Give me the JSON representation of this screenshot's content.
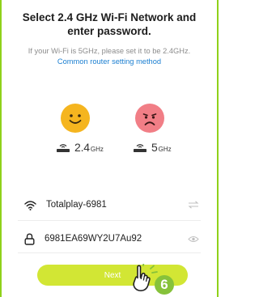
{
  "header": {
    "title_line1": "Select 2.4 GHz Wi-Fi Network and",
    "title_line2": "enter password."
  },
  "hint": {
    "text": "If your Wi-Fi is 5GHz, please set it to be 2.4GHz.",
    "link": "Common router setting method"
  },
  "bands": [
    {
      "value": "2.4",
      "unit": "GHz",
      "face_icon": "happy-face-icon",
      "face_color": "#f5b51f"
    },
    {
      "value": "5",
      "unit": "GHz",
      "face_icon": "sad-face-icon",
      "face_color": "#f17e86"
    }
  ],
  "wifi": {
    "ssid": "Totalplay-6981",
    "icon": "wifi-icon",
    "action_icon": "switch-network-icon"
  },
  "password": {
    "value": "6981EA69WY2U7Au92",
    "icon": "lock-icon",
    "action_icon": "eye-icon"
  },
  "next": {
    "label": "Next",
    "color": "#d2e634"
  },
  "annotation": {
    "step": "6",
    "color": "#86c23a"
  },
  "accent": {
    "frame": "#8fd11a",
    "link": "#1b7fd1"
  }
}
